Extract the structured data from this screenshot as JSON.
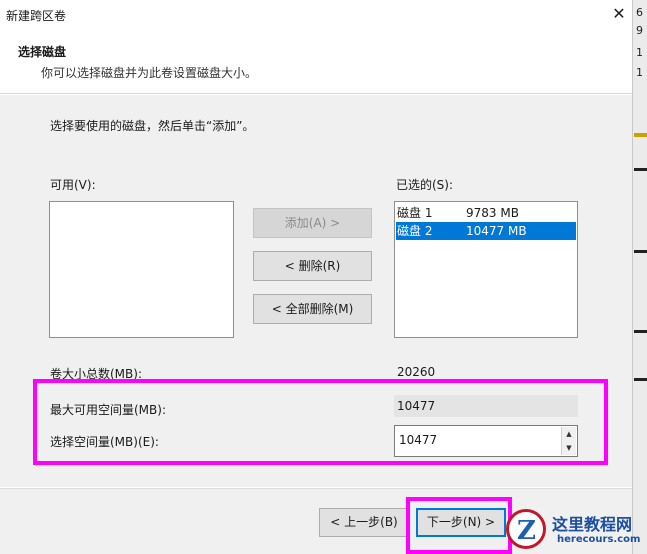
{
  "window": {
    "title": "新建跨区卷",
    "close_glyph": "✕"
  },
  "header": {
    "title": "选择磁盘",
    "subtitle": "你可以选择磁盘并为此卷设置磁盘大小。"
  },
  "instruction": "选择要使用的磁盘，然后单击“添加”。",
  "available": {
    "label": "可用(V):",
    "items": []
  },
  "selected": {
    "label": "已选的(S):",
    "items": [
      {
        "disk": "磁盘 1",
        "size": "9783 MB",
        "selected": false
      },
      {
        "disk": "磁盘 2",
        "size": "10477 MB",
        "selected": true
      }
    ]
  },
  "buttons": {
    "add": "添加(A) >",
    "remove": "< 删除(R)",
    "remove_all": "< 全部删除(M)",
    "back": "< 上一步(B)",
    "next": "下一步(N) >"
  },
  "fields": {
    "total_label": "卷大小总数(MB):",
    "total_value": "20260",
    "max_label": "最大可用空间量(MB):",
    "max_value": "10477",
    "choose_label": "选择空间量(MB)(E):",
    "choose_value": "10477"
  },
  "background_strip": {
    "chars": [
      "6",
      "9",
      "1",
      "1"
    ]
  },
  "watermark": {
    "logo_letter": "Z",
    "name": "这里教程网",
    "url": "herecours.com"
  },
  "colors": {
    "highlight": "#ff00ff",
    "selection": "#0078d7",
    "brand": "#1d4fa0"
  }
}
